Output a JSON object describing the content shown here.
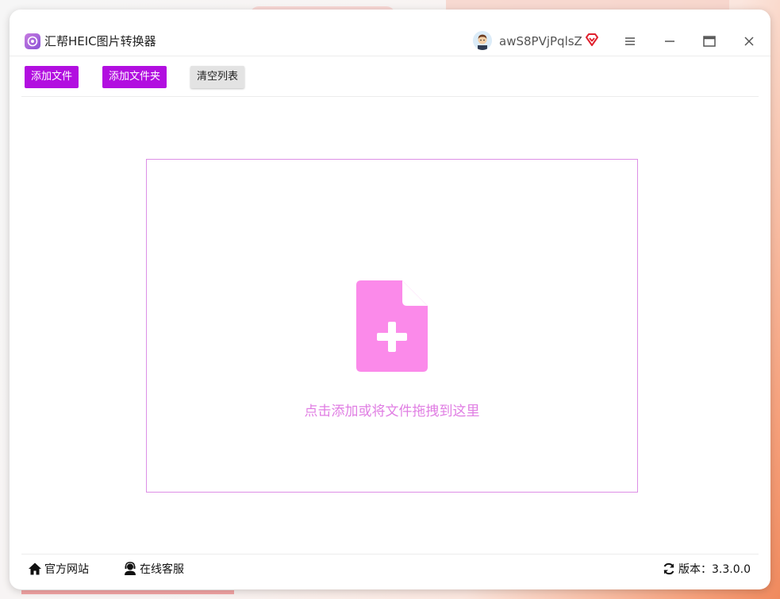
{
  "app": {
    "title": "汇帮HEIC图片转换器",
    "username": "awS8PVjPqlsZ"
  },
  "toolbar": {
    "add_file_label": "添加文件",
    "add_folder_label": "添加文件夹",
    "clear_list_label": "清空列表"
  },
  "dropzone": {
    "hint": "点击添加或将文件拖拽到这里"
  },
  "footer": {
    "website_label": "官方网站",
    "support_label": "在线客服",
    "version_label": "版本：3.3.0.0"
  },
  "colors": {
    "accent": "#b20ee0",
    "dropzone_border": "#dd8fe6",
    "dropzone_icon": "#fb8aea",
    "dropzone_text": "#e07ee3"
  },
  "icons": {
    "logo": "app-logo-icon",
    "vip": "vip-diamond-icon",
    "menu": "menu-icon",
    "minimize": "minimize-icon",
    "maximize": "maximize-icon",
    "close": "close-icon",
    "file_add": "file-add-icon",
    "home": "home-icon",
    "support": "support-icon",
    "refresh": "refresh-icon"
  }
}
